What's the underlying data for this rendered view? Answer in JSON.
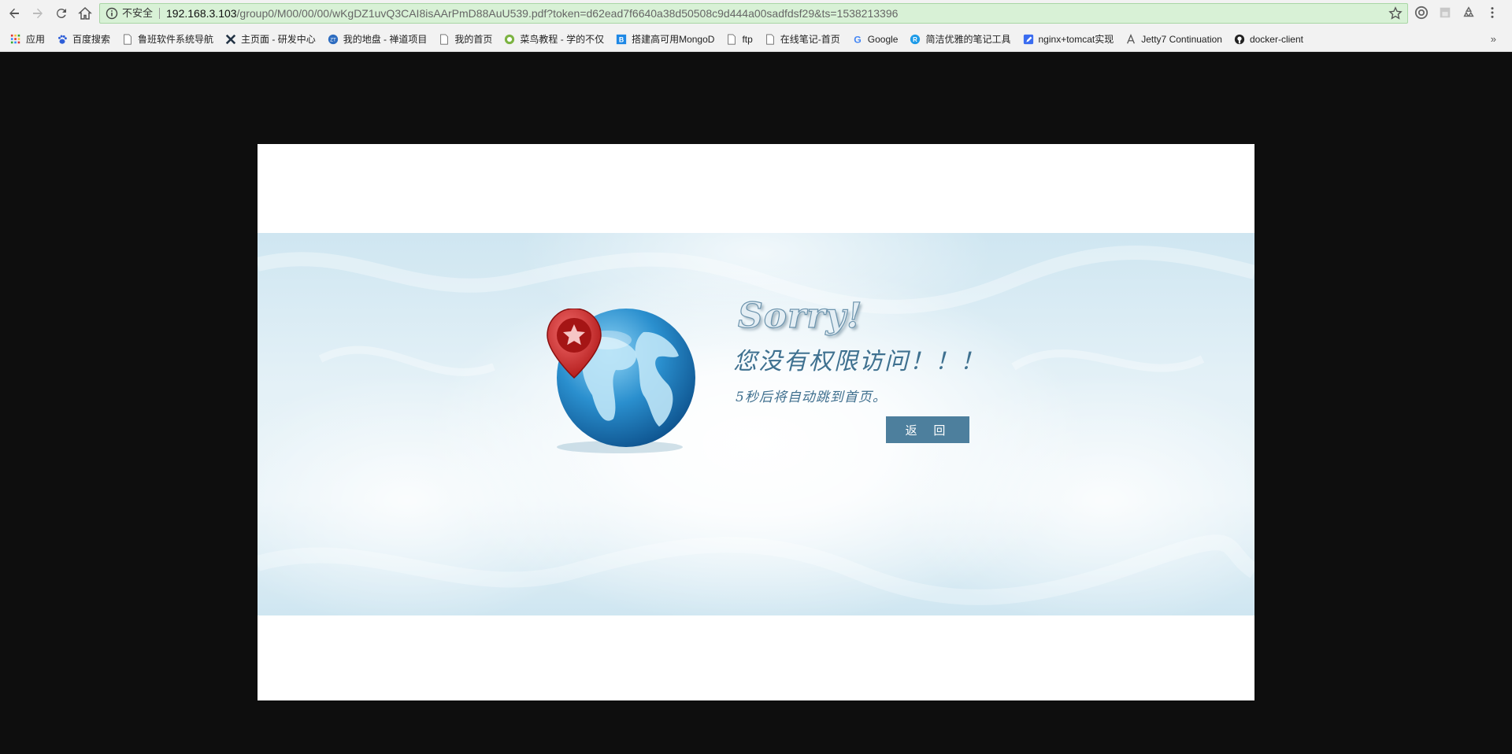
{
  "browser": {
    "address_bar": {
      "security_label": "不安全",
      "url_host": "192.168.3.103",
      "url_path": "/group0/M00/00/00/wKgDZ1uvQ3CAI8isAArPmD88AuU539.pdf?token=d62ead7f6640a38d50508c9d444a00sadfdsf29&ts=1538213396"
    },
    "bookmarks": [
      {
        "label": "应用",
        "icon": "apps-grid-icon"
      },
      {
        "label": "百度搜索",
        "icon": "baidu-paw-icon"
      },
      {
        "label": "鲁班软件系统导航",
        "icon": "page-icon"
      },
      {
        "label": "主页面 - 研发中心",
        "icon": "x-logo-icon"
      },
      {
        "label": "我的地盘 - 禅道项目",
        "icon": "zentao-icon"
      },
      {
        "label": "我的首页",
        "icon": "page-icon"
      },
      {
        "label": "菜鸟教程 - 学的不仅",
        "icon": "runoob-icon"
      },
      {
        "label": "搭建高可用MongoD",
        "icon": "b-logo-icon"
      },
      {
        "label": "ftp",
        "icon": "page-icon"
      },
      {
        "label": "在线笔记-首页",
        "icon": "page-icon"
      },
      {
        "label": "Google",
        "icon": "google-icon"
      },
      {
        "label": "简洁优雅的笔记工具",
        "icon": "r-circle-icon"
      },
      {
        "label": "nginx+tomcat实现",
        "icon": "pencil-note-icon"
      },
      {
        "label": "Jetty7 Continuation",
        "icon": "jetty-icon"
      },
      {
        "label": "docker-client",
        "icon": "github-icon"
      }
    ],
    "bookmarks_more": "»"
  },
  "error_page": {
    "sorry": "Sorry!",
    "message": "您没有权限访问！！！",
    "redirect_notice": "5秒后将自动跳到首页。",
    "back_button": "返 回"
  },
  "colors": {
    "page_background": "#0e0e0e",
    "banner_blue": "#cfe6f1",
    "accent_text": "#3f7190",
    "button_bg": "#4d7f9d"
  }
}
